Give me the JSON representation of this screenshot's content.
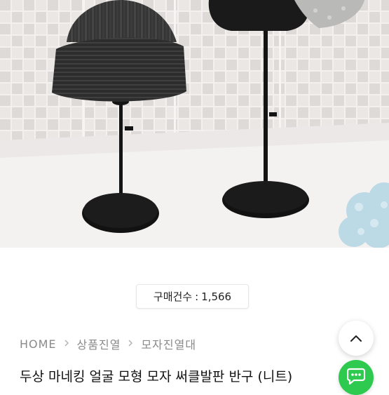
{
  "product_image": {
    "icon": "product-photo-hat-stands",
    "colors": {
      "background": "#f1eeee",
      "lattice": "#dcd8d6",
      "hat_dark": "#2f302f",
      "stand": "#141414",
      "flowers": "#bcd9e6"
    }
  },
  "purchase_badge": {
    "label": "구매건수",
    "separator": ":",
    "count": "1,566"
  },
  "breadcrumb": {
    "items": [
      "HOME",
      "상품진열",
      "모자진열대"
    ],
    "separator_icon": "chevron-right-icon"
  },
  "product_title": "두상 마네킹 얼굴 모형 모자 써클발판 반구 (니트)",
  "floating": {
    "scroll_top_icon": "chevron-up-icon",
    "chat_icon": "chat-bubble-icon",
    "chat_color": "#2ec94f"
  }
}
